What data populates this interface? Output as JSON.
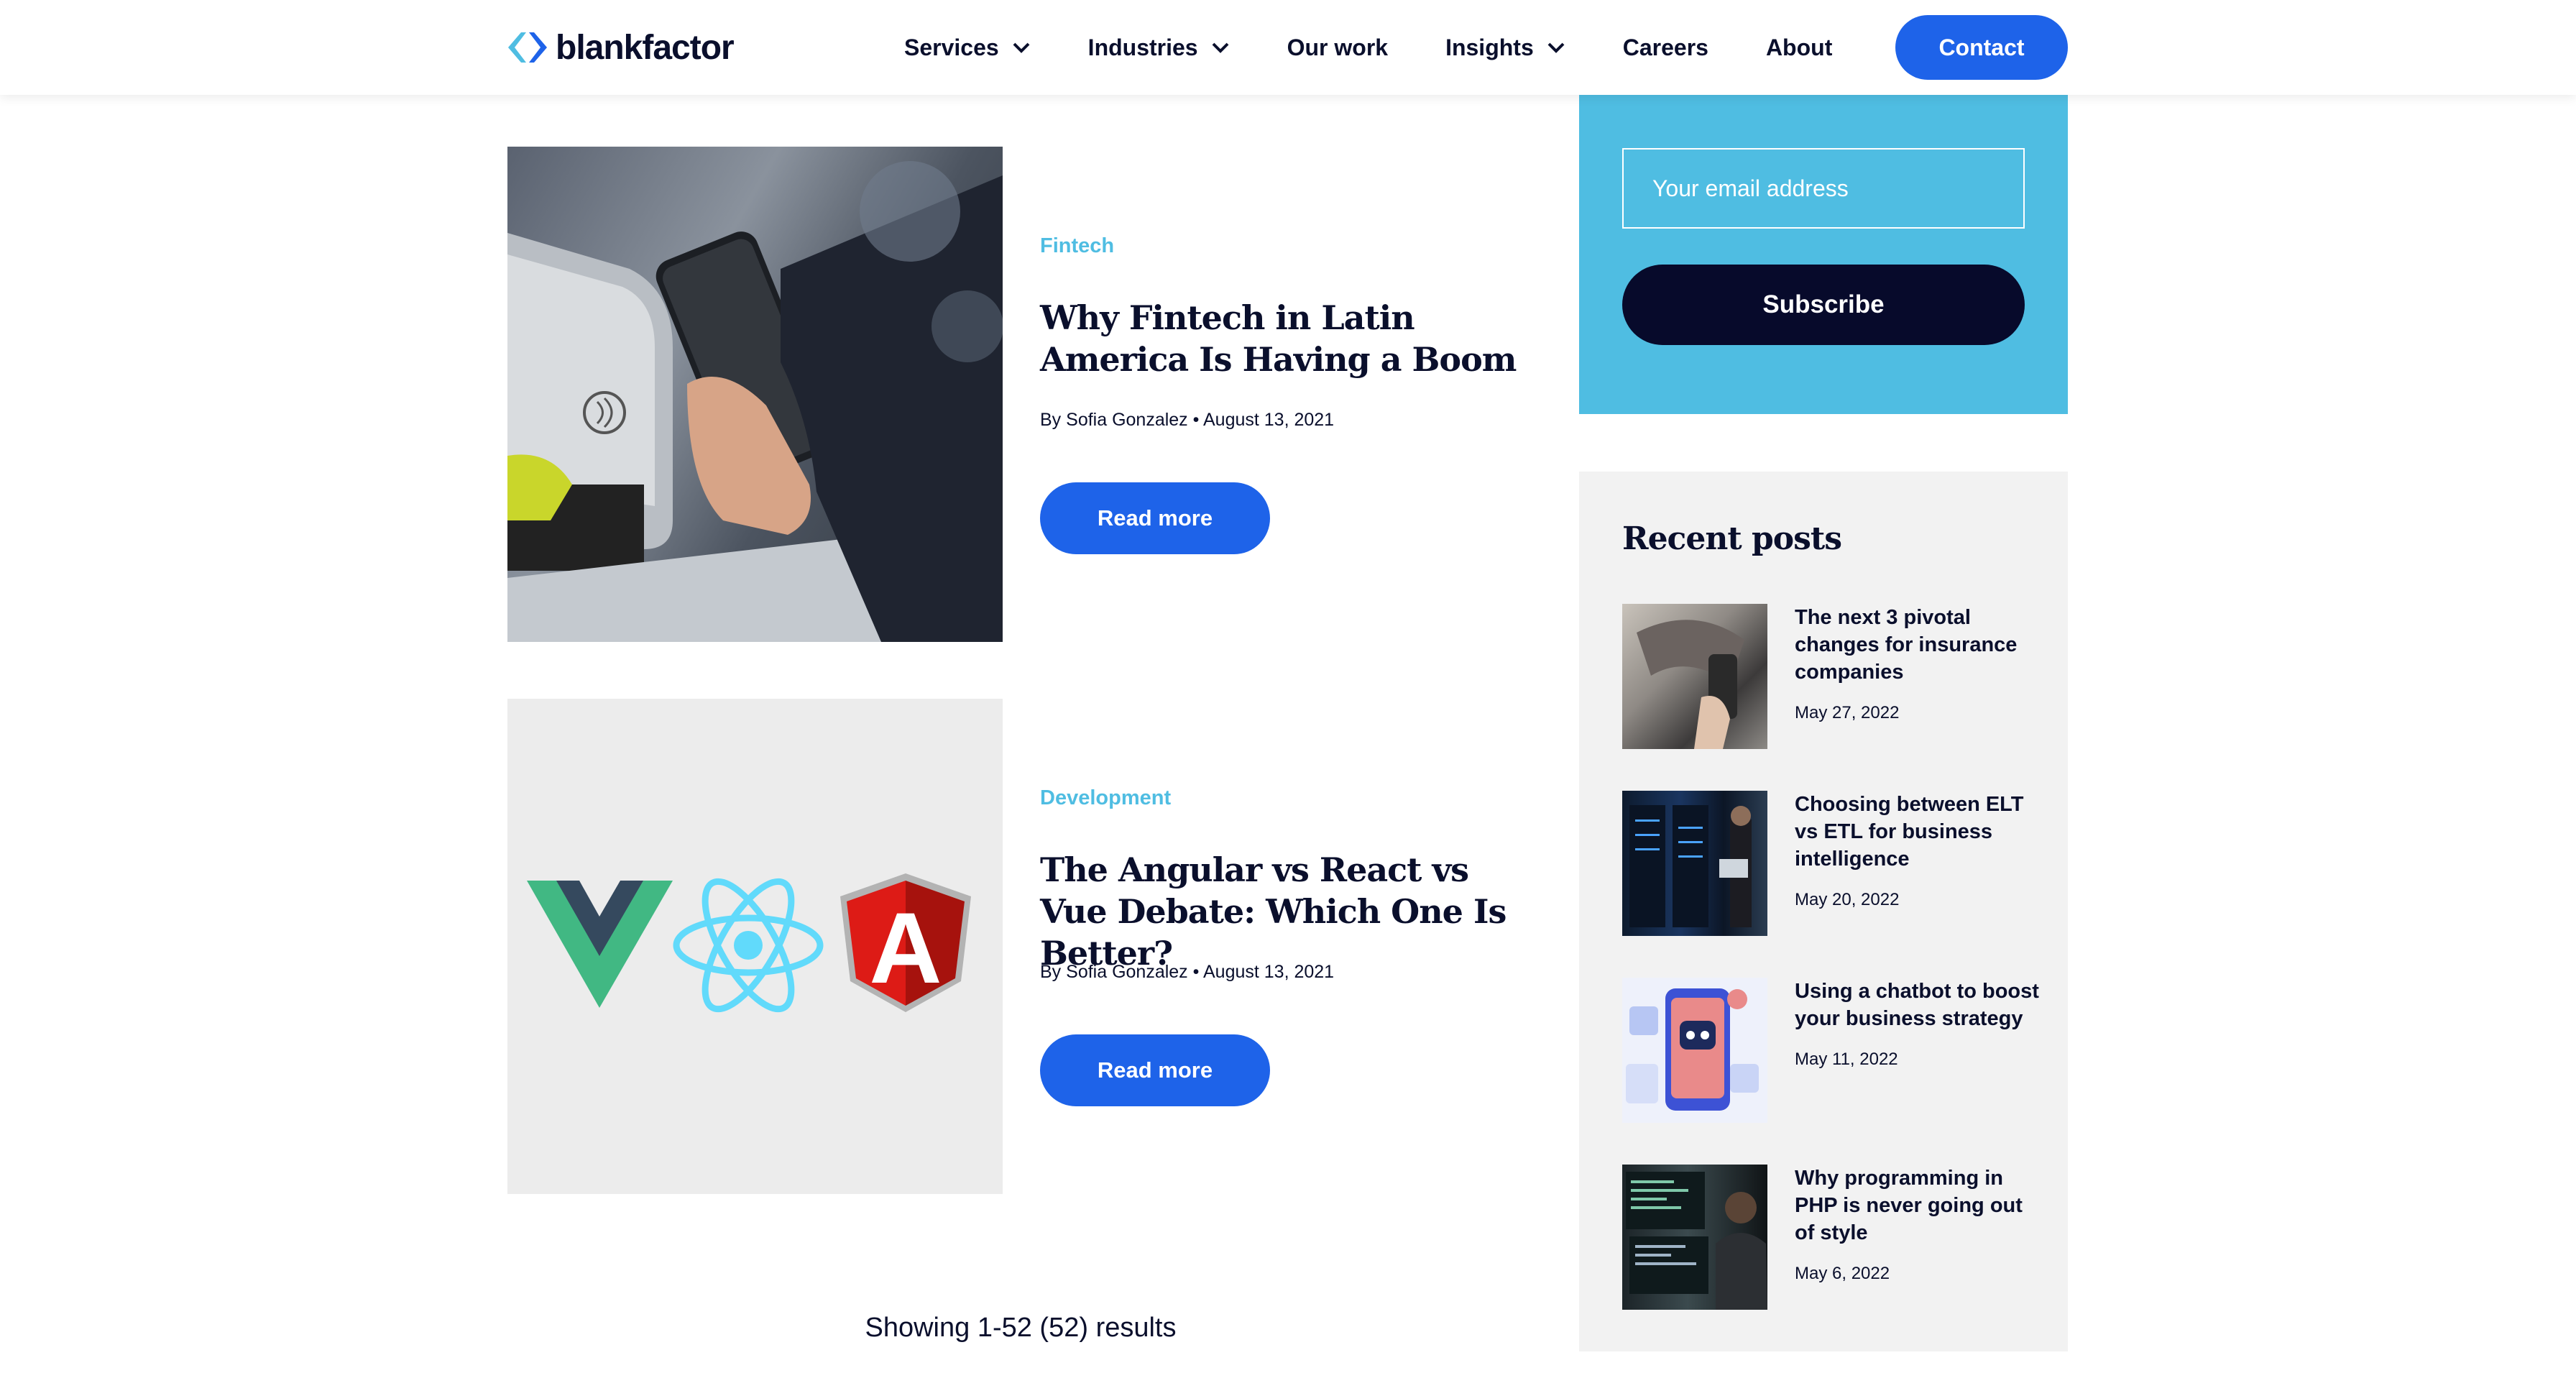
{
  "header": {
    "logo_text": "blankfactor",
    "nav": [
      {
        "label": "Services",
        "has_dropdown": true
      },
      {
        "label": "Industries",
        "has_dropdown": true
      },
      {
        "label": "Our work",
        "has_dropdown": false
      },
      {
        "label": "Insights",
        "has_dropdown": true
      },
      {
        "label": "Careers",
        "has_dropdown": false
      },
      {
        "label": "About",
        "has_dropdown": false
      }
    ],
    "contact_label": "Contact"
  },
  "articles": [
    {
      "category": "Fintech",
      "title": "Why Fintech in Latin America Is Having a Boom",
      "by": "By",
      "author": "Sofia Gonzalez",
      "separator": "•",
      "date": "August 13, 2021",
      "read_more": "Read more",
      "image_icon": "contactless-payment-photo"
    },
    {
      "category": "Development",
      "title": "The Angular vs React vs Vue Debate: Which One Is Better?",
      "by": "By",
      "author": "Sofia Gonzalez",
      "separator": "•",
      "date": "August 13, 2021",
      "read_more": "Read more",
      "image_icon": "vue-react-angular-logos",
      "logo_letter": "A"
    }
  ],
  "results_text": "Showing 1-52 (52) results",
  "sidebar": {
    "email_placeholder": "Your email address",
    "subscribe_label": "Subscribe",
    "recent_title": "Recent posts",
    "recent_posts": [
      {
        "title": "The next 3 pivotal changes for insurance companies",
        "date": "May 27, 2022"
      },
      {
        "title": "Choosing between ELT vs ETL for business intelligence",
        "date": "May 20, 2022"
      },
      {
        "title": "Using a chatbot to boost your business strategy",
        "date": "May 11, 2022"
      },
      {
        "title": "Why programming in PHP is never going out of style",
        "date": "May 6, 2022"
      }
    ]
  },
  "colors": {
    "accent_blue": "#1e63e9",
    "cyan": "#4fbde2",
    "navy": "#070a2b",
    "text": "#0a0f2c",
    "sidebar_bg": "#f2f2f2"
  }
}
